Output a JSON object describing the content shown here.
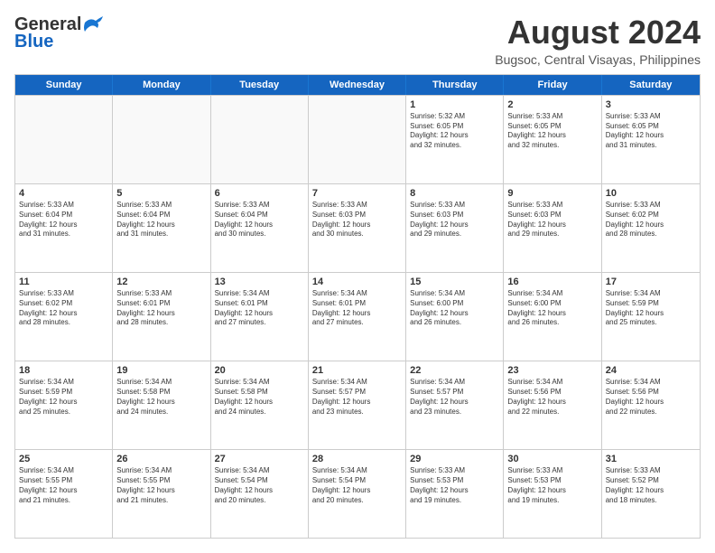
{
  "header": {
    "logo_general": "General",
    "logo_blue": "Blue",
    "month_title": "August 2024",
    "location": "Bugsoc, Central Visayas, Philippines"
  },
  "calendar": {
    "days_of_week": [
      "Sunday",
      "Monday",
      "Tuesday",
      "Wednesday",
      "Thursday",
      "Friday",
      "Saturday"
    ],
    "rows": [
      [
        {
          "day": "",
          "info": "",
          "empty": true
        },
        {
          "day": "",
          "info": "",
          "empty": true
        },
        {
          "day": "",
          "info": "",
          "empty": true
        },
        {
          "day": "",
          "info": "",
          "empty": true
        },
        {
          "day": "1",
          "info": "Sunrise: 5:32 AM\nSunset: 6:05 PM\nDaylight: 12 hours\nand 32 minutes."
        },
        {
          "day": "2",
          "info": "Sunrise: 5:33 AM\nSunset: 6:05 PM\nDaylight: 12 hours\nand 32 minutes."
        },
        {
          "day": "3",
          "info": "Sunrise: 5:33 AM\nSunset: 6:05 PM\nDaylight: 12 hours\nand 31 minutes."
        }
      ],
      [
        {
          "day": "4",
          "info": "Sunrise: 5:33 AM\nSunset: 6:04 PM\nDaylight: 12 hours\nand 31 minutes."
        },
        {
          "day": "5",
          "info": "Sunrise: 5:33 AM\nSunset: 6:04 PM\nDaylight: 12 hours\nand 31 minutes."
        },
        {
          "day": "6",
          "info": "Sunrise: 5:33 AM\nSunset: 6:04 PM\nDaylight: 12 hours\nand 30 minutes."
        },
        {
          "day": "7",
          "info": "Sunrise: 5:33 AM\nSunset: 6:03 PM\nDaylight: 12 hours\nand 30 minutes."
        },
        {
          "day": "8",
          "info": "Sunrise: 5:33 AM\nSunset: 6:03 PM\nDaylight: 12 hours\nand 29 minutes."
        },
        {
          "day": "9",
          "info": "Sunrise: 5:33 AM\nSunset: 6:03 PM\nDaylight: 12 hours\nand 29 minutes."
        },
        {
          "day": "10",
          "info": "Sunrise: 5:33 AM\nSunset: 6:02 PM\nDaylight: 12 hours\nand 28 minutes."
        }
      ],
      [
        {
          "day": "11",
          "info": "Sunrise: 5:33 AM\nSunset: 6:02 PM\nDaylight: 12 hours\nand 28 minutes."
        },
        {
          "day": "12",
          "info": "Sunrise: 5:33 AM\nSunset: 6:01 PM\nDaylight: 12 hours\nand 28 minutes."
        },
        {
          "day": "13",
          "info": "Sunrise: 5:34 AM\nSunset: 6:01 PM\nDaylight: 12 hours\nand 27 minutes."
        },
        {
          "day": "14",
          "info": "Sunrise: 5:34 AM\nSunset: 6:01 PM\nDaylight: 12 hours\nand 27 minutes."
        },
        {
          "day": "15",
          "info": "Sunrise: 5:34 AM\nSunset: 6:00 PM\nDaylight: 12 hours\nand 26 minutes."
        },
        {
          "day": "16",
          "info": "Sunrise: 5:34 AM\nSunset: 6:00 PM\nDaylight: 12 hours\nand 26 minutes."
        },
        {
          "day": "17",
          "info": "Sunrise: 5:34 AM\nSunset: 5:59 PM\nDaylight: 12 hours\nand 25 minutes."
        }
      ],
      [
        {
          "day": "18",
          "info": "Sunrise: 5:34 AM\nSunset: 5:59 PM\nDaylight: 12 hours\nand 25 minutes."
        },
        {
          "day": "19",
          "info": "Sunrise: 5:34 AM\nSunset: 5:58 PM\nDaylight: 12 hours\nand 24 minutes."
        },
        {
          "day": "20",
          "info": "Sunrise: 5:34 AM\nSunset: 5:58 PM\nDaylight: 12 hours\nand 24 minutes."
        },
        {
          "day": "21",
          "info": "Sunrise: 5:34 AM\nSunset: 5:57 PM\nDaylight: 12 hours\nand 23 minutes."
        },
        {
          "day": "22",
          "info": "Sunrise: 5:34 AM\nSunset: 5:57 PM\nDaylight: 12 hours\nand 23 minutes."
        },
        {
          "day": "23",
          "info": "Sunrise: 5:34 AM\nSunset: 5:56 PM\nDaylight: 12 hours\nand 22 minutes."
        },
        {
          "day": "24",
          "info": "Sunrise: 5:34 AM\nSunset: 5:56 PM\nDaylight: 12 hours\nand 22 minutes."
        }
      ],
      [
        {
          "day": "25",
          "info": "Sunrise: 5:34 AM\nSunset: 5:55 PM\nDaylight: 12 hours\nand 21 minutes."
        },
        {
          "day": "26",
          "info": "Sunrise: 5:34 AM\nSunset: 5:55 PM\nDaylight: 12 hours\nand 21 minutes."
        },
        {
          "day": "27",
          "info": "Sunrise: 5:34 AM\nSunset: 5:54 PM\nDaylight: 12 hours\nand 20 minutes."
        },
        {
          "day": "28",
          "info": "Sunrise: 5:34 AM\nSunset: 5:54 PM\nDaylight: 12 hours\nand 20 minutes."
        },
        {
          "day": "29",
          "info": "Sunrise: 5:33 AM\nSunset: 5:53 PM\nDaylight: 12 hours\nand 19 minutes."
        },
        {
          "day": "30",
          "info": "Sunrise: 5:33 AM\nSunset: 5:53 PM\nDaylight: 12 hours\nand 19 minutes."
        },
        {
          "day": "31",
          "info": "Sunrise: 5:33 AM\nSunset: 5:52 PM\nDaylight: 12 hours\nand 18 minutes."
        }
      ]
    ]
  }
}
